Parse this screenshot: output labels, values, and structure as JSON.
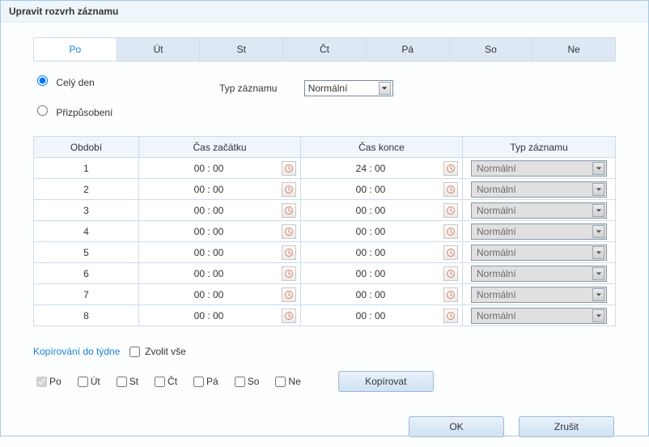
{
  "title": "Upravit rozvrh záznamu",
  "tabs": [
    "Po",
    "Út",
    "St",
    "Čt",
    "Pá",
    "So",
    "Ne"
  ],
  "activeTab": 0,
  "radios": {
    "all_day": "Celý den",
    "custom": "Přizpůsobení",
    "selected": "all_day"
  },
  "type_label": "Typ záznamu",
  "type_value": "Normální",
  "columns": {
    "period": "Období",
    "start": "Čas začátku",
    "end": "Čas konce",
    "type": "Typ záznamu"
  },
  "rows": [
    {
      "period": "1",
      "start": "00 : 00",
      "end": "24 : 00",
      "type": "Normální"
    },
    {
      "period": "2",
      "start": "00 : 00",
      "end": "00 : 00",
      "type": "Normální"
    },
    {
      "period": "3",
      "start": "00 : 00",
      "end": "00 : 00",
      "type": "Normální"
    },
    {
      "period": "4",
      "start": "00 : 00",
      "end": "00 : 00",
      "type": "Normální"
    },
    {
      "period": "5",
      "start": "00 : 00",
      "end": "00 : 00",
      "type": "Normální"
    },
    {
      "period": "6",
      "start": "00 : 00",
      "end": "00 : 00",
      "type": "Normální"
    },
    {
      "period": "7",
      "start": "00 : 00",
      "end": "00 : 00",
      "type": "Normální"
    },
    {
      "period": "8",
      "start": "00 : 00",
      "end": "00 : 00",
      "type": "Normální"
    }
  ],
  "copy": {
    "label": "Kopírování do týdne",
    "select_all": "Zvolit vše",
    "days": [
      {
        "label": "Po",
        "checked": true
      },
      {
        "label": "Út",
        "checked": false
      },
      {
        "label": "St",
        "checked": false
      },
      {
        "label": "Čt",
        "checked": false
      },
      {
        "label": "Pá",
        "checked": false
      },
      {
        "label": "So",
        "checked": false
      },
      {
        "label": "Ne",
        "checked": false
      }
    ],
    "button": "Kopírovat"
  },
  "buttons": {
    "ok": "OK",
    "cancel": "Zrušit"
  }
}
